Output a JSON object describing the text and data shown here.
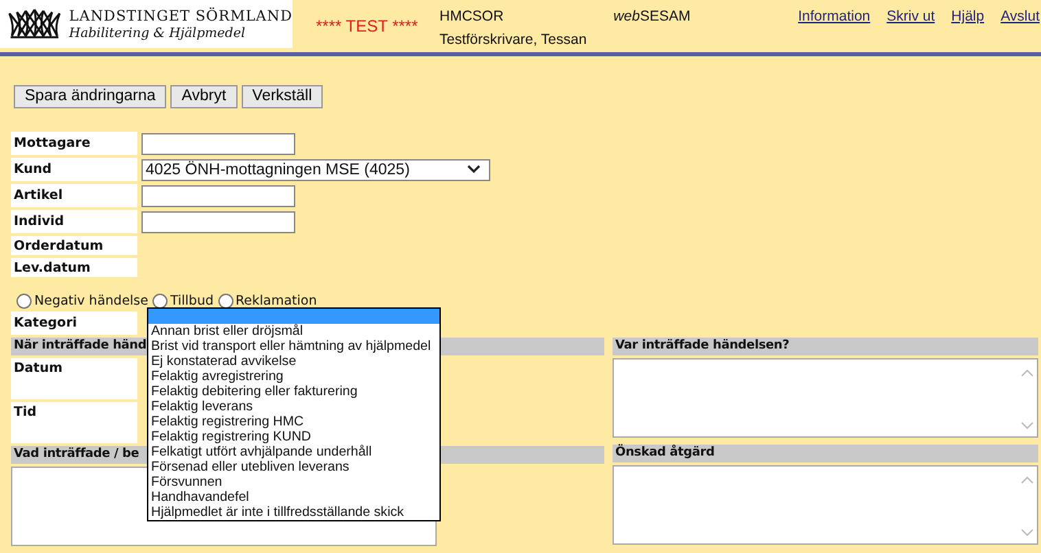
{
  "header": {
    "logo_title": "LANDSTINGET SÖRMLAND",
    "logo_subtitle": "Habilitering & Hjälpmedel",
    "test_banner": "**** TEST ****",
    "system_code": "HMCSOR",
    "user": "Testförskrivare, Tessan",
    "app_name_prefix": "web",
    "app_name": "SESAM",
    "links": [
      "Information",
      "Skriv ut",
      "Hjälp",
      "Avslut"
    ]
  },
  "toolbar": {
    "buttons": [
      "Spara ändringarna",
      "Avbryt",
      "Verkställ"
    ]
  },
  "fields": [
    {
      "label": "Mottagare",
      "kind": "input"
    },
    {
      "label": "Kund",
      "kind": "select",
      "value": "4025 ÖNH-mottagningen MSE (4025)"
    },
    {
      "label": "Artikel",
      "kind": "input"
    },
    {
      "label": "Individ",
      "kind": "input"
    },
    {
      "label": "Orderdatum",
      "kind": "text"
    },
    {
      "label": "Lev.datum",
      "kind": "text"
    }
  ],
  "event_types": [
    {
      "label": "Negativ händelse",
      "selected": false
    },
    {
      "label": "Tillbud",
      "selected": false
    },
    {
      "label": "Reklamation",
      "selected": false
    }
  ],
  "category": {
    "label": "Kategori",
    "blank_highlighted": true,
    "options": [
      {
        "label": "Annan brist eller dröjsmål",
        "selected": false
      },
      {
        "label": "Brist vid transport eller hämtning av hjälpmedel",
        "selected": false
      },
      {
        "label": "Ej konstaterad avvikelse",
        "selected": false
      },
      {
        "label": "Felaktig avregistrering",
        "selected": false
      },
      {
        "label": "Felaktig debitering eller fakturering",
        "selected": false
      },
      {
        "label": "Felaktig leverans",
        "selected": false
      },
      {
        "label": "Felaktig registrering HMC",
        "selected": false
      },
      {
        "label": "Felaktig registrering KUND",
        "selected": false
      },
      {
        "label": "Felkatigt utfört avhjälpande underhåll",
        "selected": false
      },
      {
        "label": "Försenad eller utebliven leverans",
        "selected": false
      },
      {
        "label": "Försvunnen",
        "selected": false
      },
      {
        "label": "Handhavandefel",
        "selected": false
      },
      {
        "label": "Hjälpmedlet är inte i tillfredsställande skick",
        "selected": false
      }
    ]
  },
  "when": {
    "heading": "När inträffade händ",
    "date_label": "Datum",
    "time_label": "Tid"
  },
  "where": {
    "heading": "Var inträffade händelsen?"
  },
  "what": {
    "heading": "Vad inträffade / be"
  },
  "action": {
    "heading": "Önskad åtgärd"
  }
}
